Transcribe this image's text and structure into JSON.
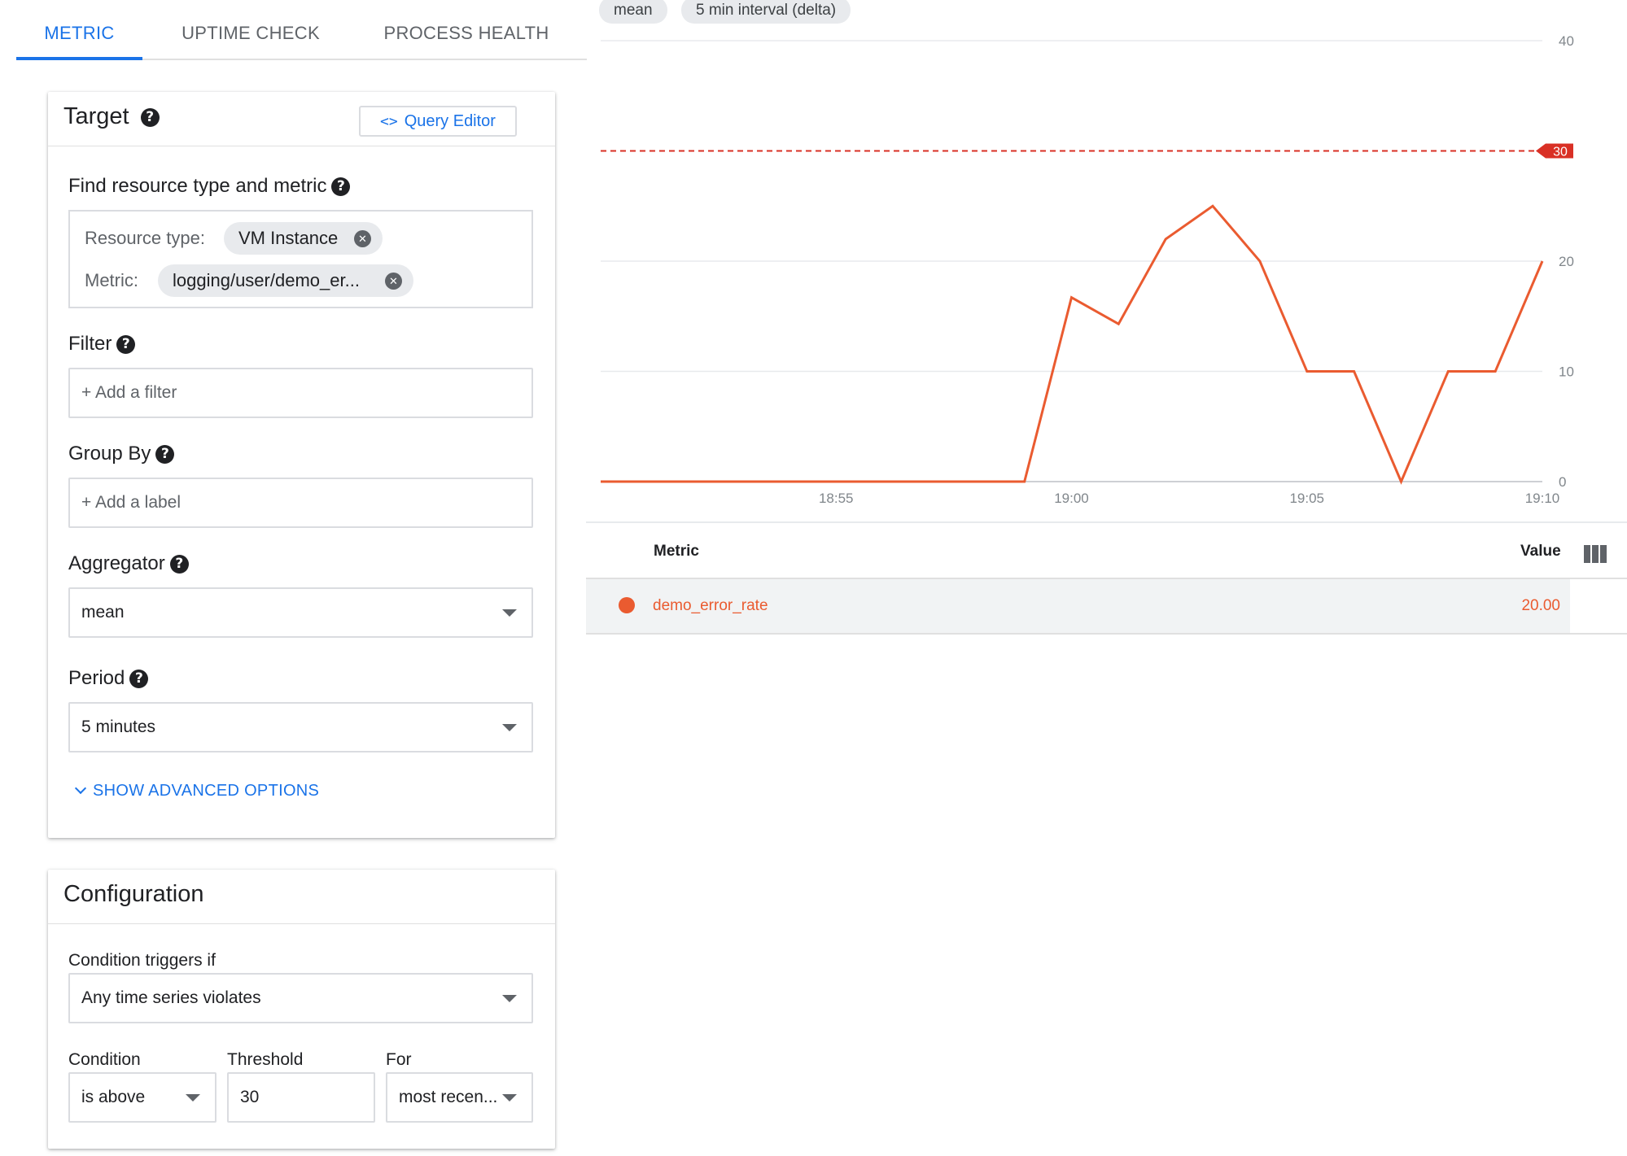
{
  "tabs": [
    {
      "label": "METRIC",
      "active": true
    },
    {
      "label": "UPTIME CHECK",
      "active": false
    },
    {
      "label": "PROCESS HEALTH",
      "active": false
    }
  ],
  "target": {
    "title": "Target",
    "query_editor_label": "Query Editor",
    "find_label": "Find resource type and metric",
    "resource_type_label": "Resource type:",
    "resource_type_value": "VM Instance",
    "metric_label": "Metric:",
    "metric_value": "logging/user/demo_er...",
    "filter_label": "Filter",
    "filter_placeholder": "+ Add a filter",
    "group_by_label": "Group By",
    "group_by_placeholder": "+ Add a label",
    "aggregator_label": "Aggregator",
    "aggregator_value": "mean",
    "period_label": "Period",
    "period_value": "5 minutes",
    "advanced_label": "SHOW ADVANCED OPTIONS"
  },
  "configuration": {
    "title": "Configuration",
    "triggers_label": "Condition triggers if",
    "triggers_value": "Any time series violates",
    "condition_label": "Condition",
    "condition_value": "is above",
    "threshold_label": "Threshold",
    "threshold_value": "30",
    "for_label": "For",
    "for_value": "most recen..."
  },
  "chart_pills": [
    "mean",
    "5 min interval (delta)"
  ],
  "chart_data": {
    "type": "line",
    "x": [
      "18:50",
      "18:51",
      "18:52",
      "18:53",
      "18:54",
      "18:55",
      "18:56",
      "18:57",
      "18:58",
      "18:59",
      "19:00",
      "19:01",
      "19:02",
      "19:03",
      "19:04",
      "19:05",
      "19:06",
      "19:07",
      "19:08",
      "19:09",
      "19:10"
    ],
    "series": [
      {
        "name": "demo_error_rate",
        "color": "#ea5b30",
        "values": [
          0,
          0,
          0,
          0,
          0,
          0,
          0,
          0,
          0,
          0,
          16.7,
          14.3,
          22,
          25,
          20,
          10,
          10,
          0,
          10,
          10,
          20
        ]
      }
    ],
    "x_tick_labels": [
      "18:55",
      "19:00",
      "19:05",
      "19:10"
    ],
    "y_ticks": [
      "0",
      "10",
      "20",
      "40"
    ],
    "ylim": [
      0,
      40
    ],
    "threshold": {
      "value": 30,
      "label": "30",
      "color": "#d93025"
    },
    "grid": true
  },
  "table": {
    "metric_header": "Metric",
    "value_header": "Value",
    "rows": [
      {
        "metric": "demo_error_rate",
        "value": "20.00",
        "color": "#ea5b30"
      }
    ]
  }
}
